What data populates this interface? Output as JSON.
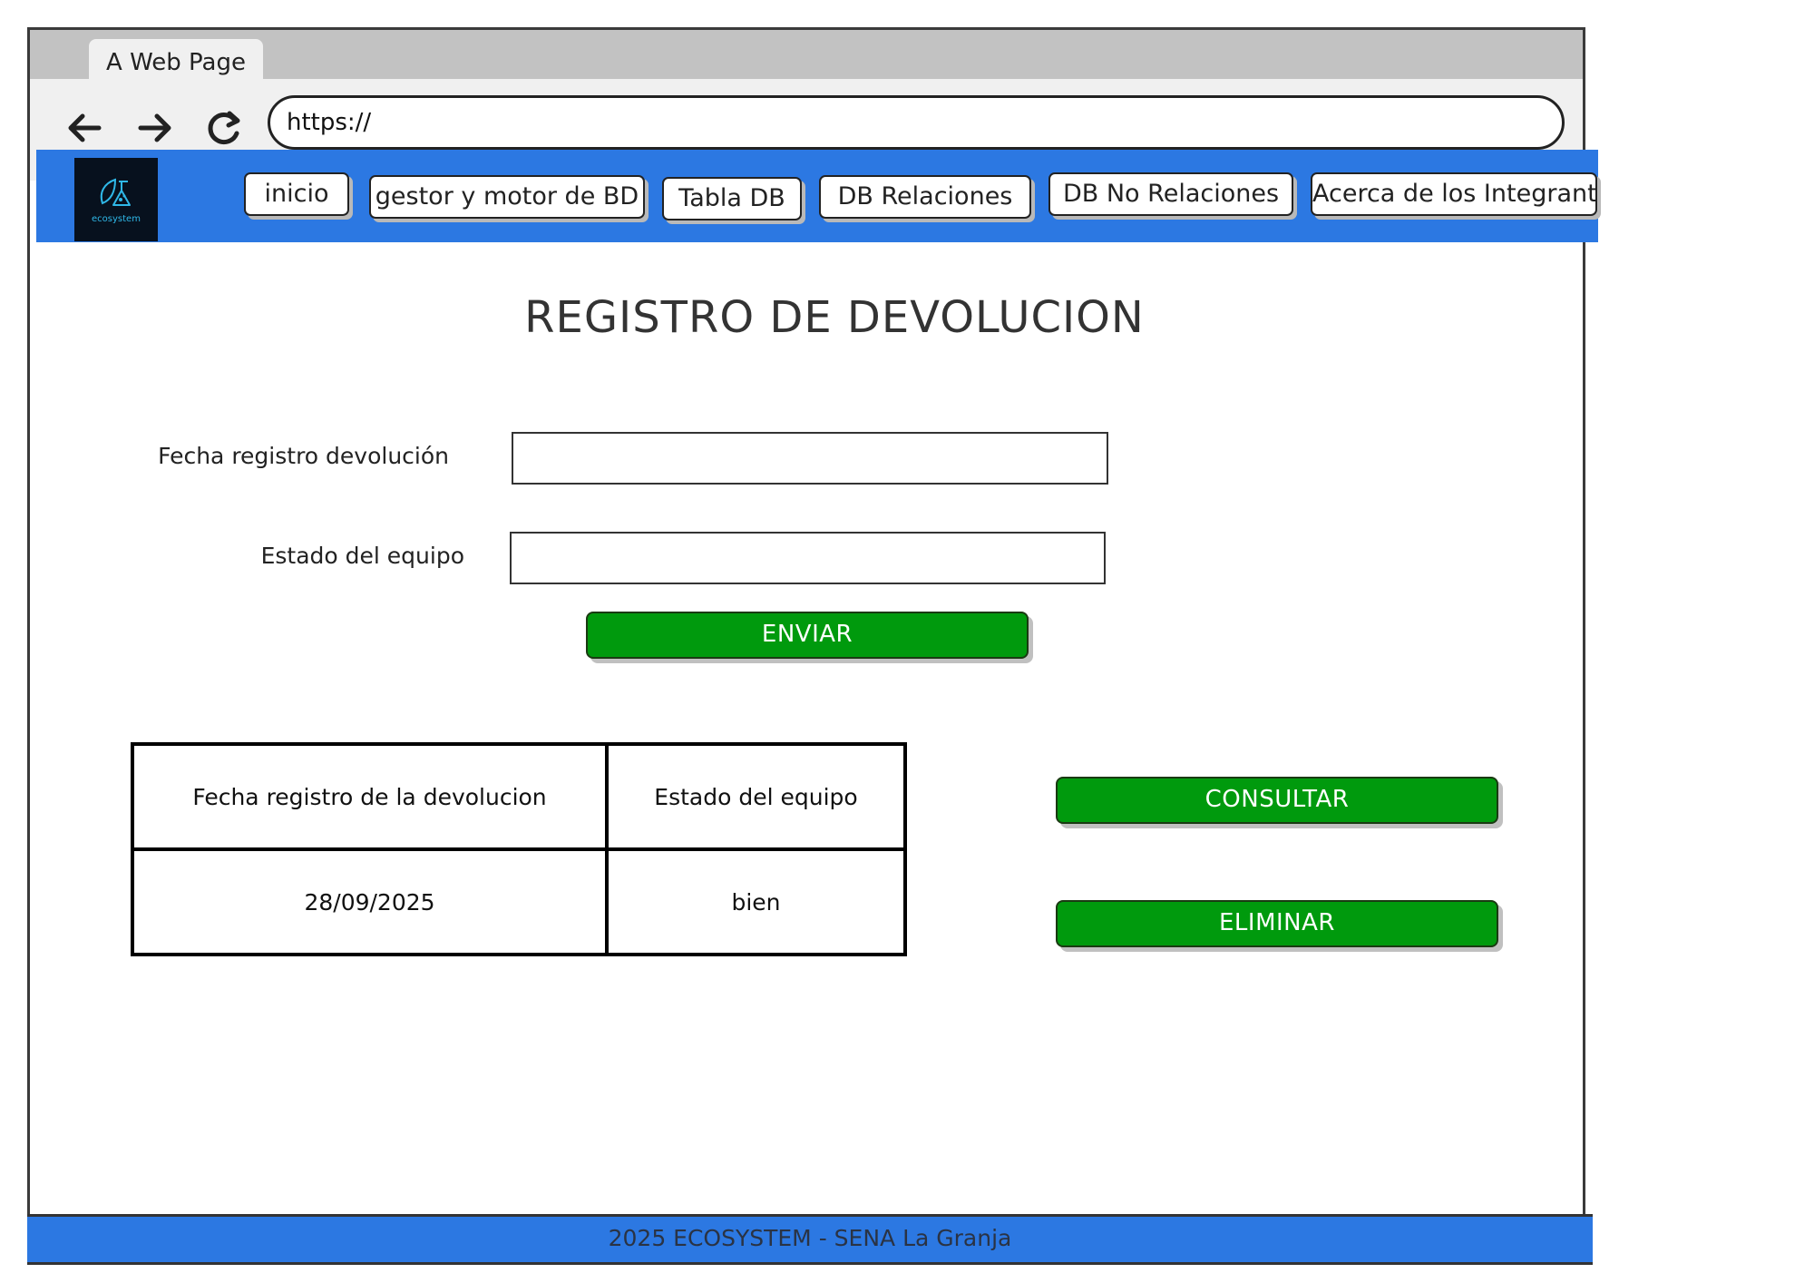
{
  "browser": {
    "tab_title": "A Web Page",
    "url": "https://"
  },
  "navbar": {
    "logo_text": "ecosystem",
    "items": [
      {
        "label": "inicio"
      },
      {
        "label": "gestor y motor de BD"
      },
      {
        "label": "Tabla DB"
      },
      {
        "label": "DB Relaciones"
      },
      {
        "label": "DB No Relaciones"
      },
      {
        "label": "Acerca de los Integrante"
      }
    ],
    "color": "#2c78e2"
  },
  "form": {
    "title": "REGISTRO DE DEVOLUCION",
    "fields": [
      {
        "label": "Fecha registro devolución",
        "value": ""
      },
      {
        "label": "Estado del equipo",
        "value": ""
      }
    ],
    "submit_label": "ENVIAR"
  },
  "table": {
    "headers": [
      "Fecha  registro de la devolucion",
      "Estado del equipo"
    ],
    "rows": [
      [
        "28/09/2025",
        "bien"
      ]
    ]
  },
  "actions": {
    "consult_label": "CONSULTAR",
    "delete_label": "ELIMINAR",
    "button_color": "#009a0d"
  },
  "footer": {
    "text": "2025 ECOSYSTEM - SENA La Granja"
  }
}
